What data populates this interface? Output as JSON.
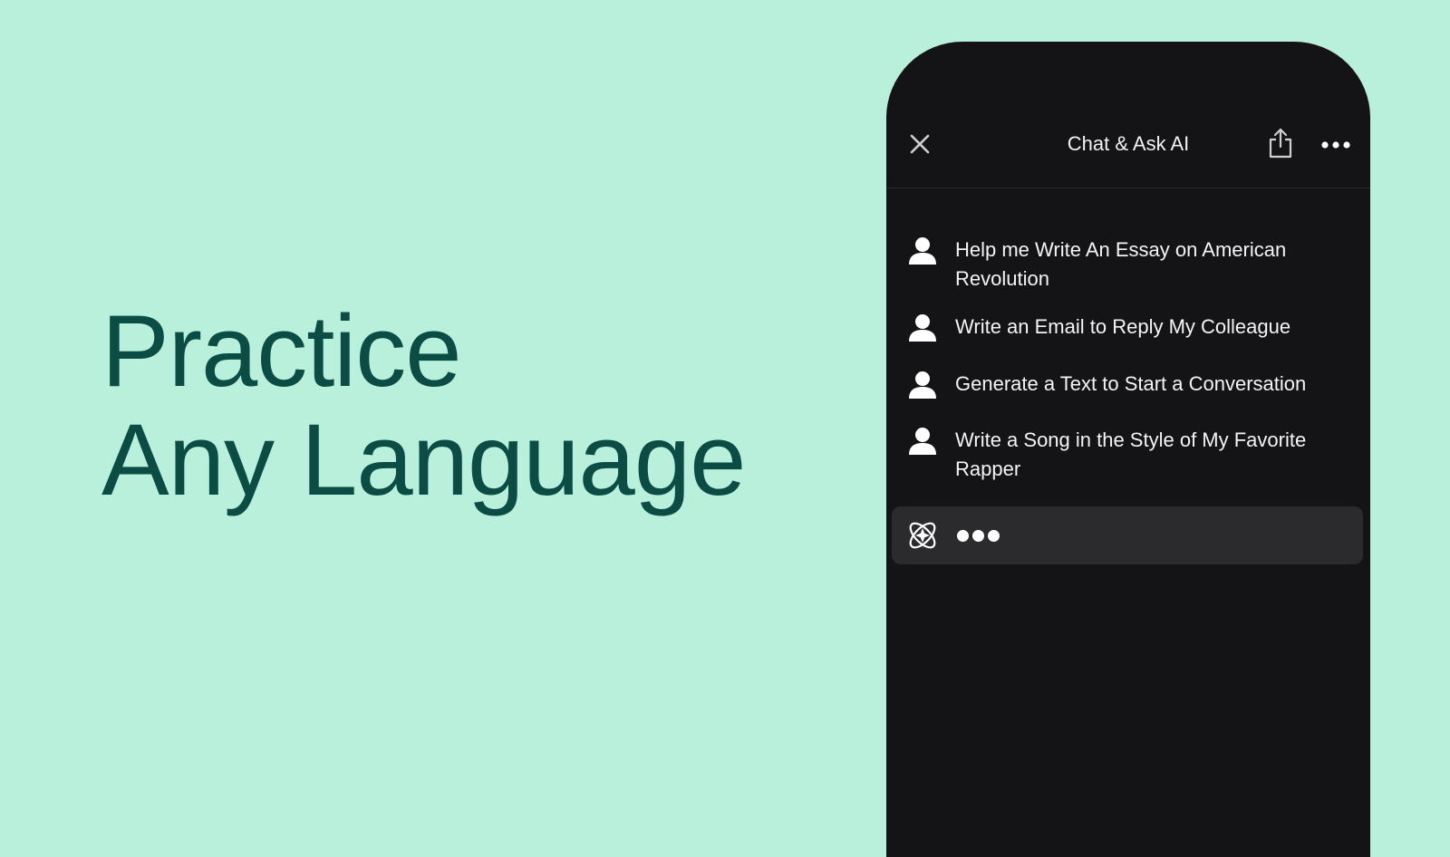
{
  "headline": {
    "line1": "Practice",
    "line2": "Any Language"
  },
  "app": {
    "title": "Chat & Ask AI",
    "icons": {
      "close": "close-icon",
      "share": "share-icon",
      "more": "more-horizontal-icon",
      "user": "user-icon",
      "ai_logo": "ai-logo-icon"
    }
  },
  "messages": [
    {
      "text": "Help me Write An Essay on American Revolution"
    },
    {
      "text": "Write an Email to Reply My Colleague"
    },
    {
      "text": "Generate a Text to Start a Conversation"
    },
    {
      "text": "Write a Song in the Style of My Favorite Rapper"
    }
  ],
  "ai_response": {
    "state": "typing"
  },
  "colors": {
    "background": "#b8f0dc",
    "headline": "#0b4d45",
    "phone": "#141416",
    "ai_row": "#2b2b2d",
    "text": "#f4f4f4"
  }
}
